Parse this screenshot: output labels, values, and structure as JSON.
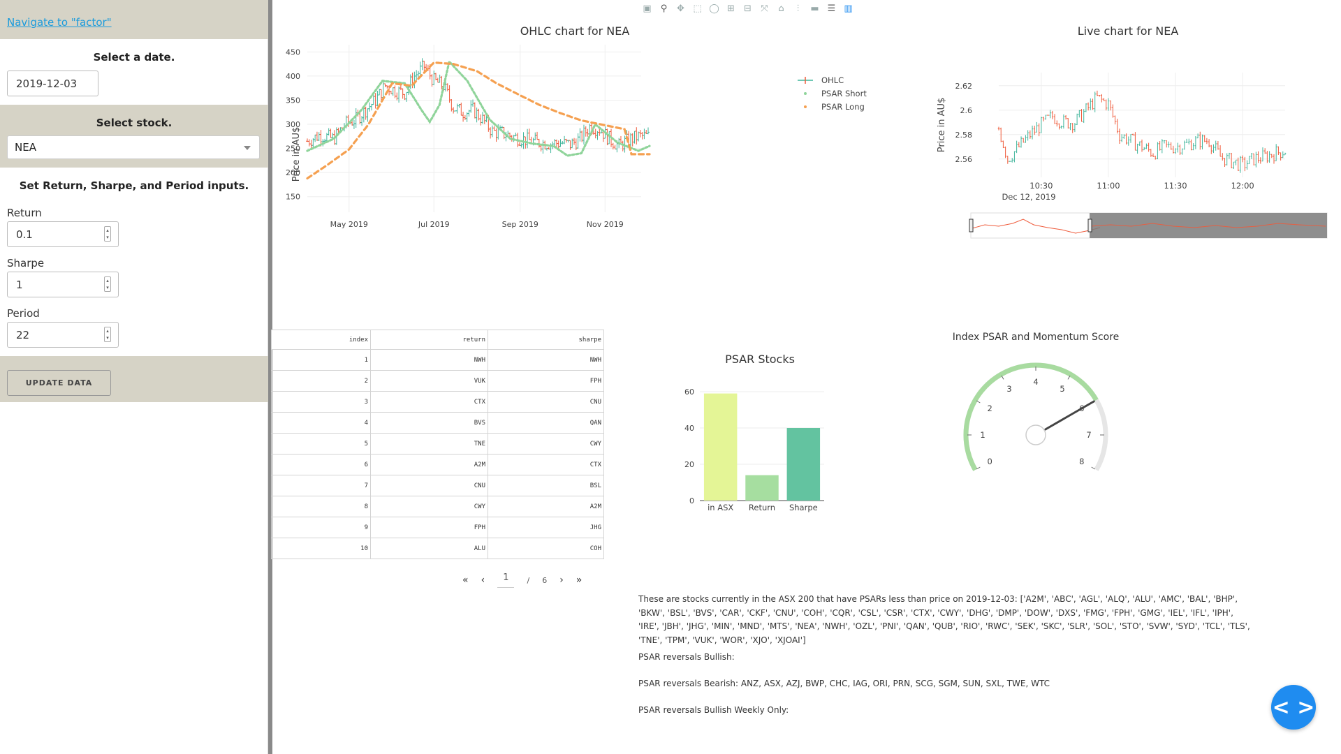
{
  "sidebar": {
    "nav_link": "Navigate to \"factor\"",
    "date_title": "Select a date.",
    "date_value": "2019-12-03",
    "stock_title": "Select stock.",
    "stock_value": "NEA",
    "inputs_title": "Set Return, Sharpe, and Period inputs.",
    "return_label": "Return",
    "return_value": "0.1",
    "sharpe_label": "Sharpe",
    "sharpe_value": "1",
    "period_label": "Period",
    "period_value": "22",
    "update_label": "UPDATE DATA",
    "colors": {
      "band": "#d6d3c6",
      "link": "#1a9bdc"
    }
  },
  "toolbar": {
    "icons": [
      "camera-icon",
      "zoom-icon",
      "pan-icon",
      "box-select-icon",
      "lasso-icon",
      "zoom-in-icon",
      "zoom-out-icon",
      "autoscale-icon",
      "reset-axes-icon",
      "spike-lines-icon",
      "hover-closest-icon",
      "hover-compare-icon",
      "plotly-logo-icon"
    ]
  },
  "chart_data": [
    {
      "type": "ohlc",
      "title": "OHLC chart for NEA",
      "ylabel": "Price in AU$",
      "ylim": [
        125,
        465
      ],
      "yticks": [
        150,
        200,
        250,
        300,
        350,
        400,
        450
      ],
      "xticks": [
        "May 2019",
        "Jul 2019",
        "Sep 2019",
        "Nov 2019"
      ],
      "x_start": "2019-04-01",
      "x_end": "2019-12-03",
      "legend": [
        "OHLC",
        "PSAR Short",
        "PSAR Long"
      ],
      "colors": {
        "up": "#3fb59b",
        "down": "#ef5a3a",
        "psar_short": "#8fd49a",
        "psar_long": "#f5a050"
      },
      "close_series": [
        [
          "2019-04-01",
          265
        ],
        [
          "2019-04-10",
          278
        ],
        [
          "2019-04-20",
          270
        ],
        [
          "2019-04-28",
          300
        ],
        [
          "2019-05-06",
          310
        ],
        [
          "2019-05-13",
          330
        ],
        [
          "2019-05-20",
          350
        ],
        [
          "2019-05-27",
          380
        ],
        [
          "2019-06-03",
          370
        ],
        [
          "2019-06-10",
          365
        ],
        [
          "2019-06-17",
          400
        ],
        [
          "2019-06-24",
          420
        ],
        [
          "2019-07-01",
          390
        ],
        [
          "2019-07-08",
          380
        ],
        [
          "2019-07-15",
          335
        ],
        [
          "2019-07-22",
          325
        ],
        [
          "2019-07-29",
          330
        ],
        [
          "2019-08-05",
          310
        ],
        [
          "2019-08-12",
          285
        ],
        [
          "2019-08-19",
          282
        ],
        [
          "2019-08-26",
          275
        ],
        [
          "2019-09-02",
          270
        ],
        [
          "2019-09-09",
          265
        ],
        [
          "2019-09-16",
          262
        ],
        [
          "2019-09-23",
          260
        ],
        [
          "2019-09-30",
          262
        ],
        [
          "2019-10-07",
          258
        ],
        [
          "2019-10-14",
          270
        ],
        [
          "2019-10-21",
          295
        ],
        [
          "2019-10-28",
          290
        ],
        [
          "2019-11-04",
          270
        ],
        [
          "2019-11-11",
          255
        ],
        [
          "2019-11-18",
          268
        ],
        [
          "2019-11-25",
          275
        ],
        [
          "2019-12-03",
          275
        ]
      ],
      "psar_long": [
        [
          "2019-04-01",
          188
        ],
        [
          "2019-04-15",
          215
        ],
        [
          "2019-05-01",
          248
        ],
        [
          "2019-05-15",
          300
        ],
        [
          "2019-06-01",
          385
        ],
        [
          "2019-06-15",
          380
        ],
        [
          "2019-07-01",
          428
        ],
        [
          "2019-07-15",
          425
        ],
        [
          "2019-08-01",
          410
        ],
        [
          "2019-08-15",
          385
        ],
        [
          "2019-09-01",
          360
        ],
        [
          "2019-09-15",
          340
        ],
        [
          "2019-10-01",
          322
        ],
        [
          "2019-10-15",
          308
        ],
        [
          "2019-11-01",
          298
        ],
        [
          "2019-11-15",
          290
        ],
        [
          "2019-11-20",
          238
        ],
        [
          "2019-12-03",
          238
        ]
      ],
      "psar_short": [
        [
          "2019-04-01",
          245
        ],
        [
          "2019-04-20",
          270
        ],
        [
          "2019-05-10",
          330
        ],
        [
          "2019-05-25",
          390
        ],
        [
          "2019-06-10",
          385
        ],
        [
          "2019-06-22",
          330
        ],
        [
          "2019-06-28",
          305
        ],
        [
          "2019-07-05",
          340
        ],
        [
          "2019-07-12",
          430
        ],
        [
          "2019-07-25",
          390
        ],
        [
          "2019-08-10",
          310
        ],
        [
          "2019-08-25",
          270
        ],
        [
          "2019-09-10",
          260
        ],
        [
          "2019-09-25",
          255
        ],
        [
          "2019-10-05",
          235
        ],
        [
          "2019-10-15",
          240
        ],
        [
          "2019-10-25",
          300
        ],
        [
          "2019-11-10",
          262
        ],
        [
          "2019-11-25",
          245
        ],
        [
          "2019-12-03",
          255
        ]
      ]
    },
    {
      "type": "ohlc",
      "title": "Live chart for NEA",
      "ylabel": "Price in AU$",
      "ylim": [
        2.545,
        2.625
      ],
      "yticks": [
        2.56,
        2.58,
        2.6,
        2.62
      ],
      "ytick_labels": [
        "2.56",
        "2.58",
        "2.6",
        "2.62"
      ],
      "xticks": [
        "10:30",
        "11:00",
        "11:30",
        "12:00"
      ],
      "xsubtitle": "Dec 12, 2019",
      "x_start": "10:11",
      "x_end": "12:19",
      "colors": {
        "up": "#3fb59b",
        "down": "#ef5a3a"
      },
      "close_series": [
        [
          "10:11",
          2.585
        ],
        [
          "10:15",
          2.56
        ],
        [
          "10:20",
          2.57
        ],
        [
          "10:25",
          2.58
        ],
        [
          "10:30",
          2.588
        ],
        [
          "10:35",
          2.595
        ],
        [
          "10:40",
          2.59
        ],
        [
          "10:45",
          2.59
        ],
        [
          "10:50",
          2.6
        ],
        [
          "10:55",
          2.61
        ],
        [
          "11:00",
          2.605
        ],
        [
          "11:05",
          2.58
        ],
        [
          "11:10",
          2.575
        ],
        [
          "11:15",
          2.57
        ],
        [
          "11:20",
          2.565
        ],
        [
          "11:25",
          2.57
        ],
        [
          "11:30",
          2.57
        ],
        [
          "11:35",
          2.572
        ],
        [
          "11:40",
          2.575
        ],
        [
          "11:45",
          2.575
        ],
        [
          "11:50",
          2.562
        ],
        [
          "11:55",
          2.558
        ],
        [
          "12:00",
          2.555
        ],
        [
          "12:05",
          2.56
        ],
        [
          "12:10",
          2.562
        ],
        [
          "12:15",
          2.565
        ],
        [
          "12:19",
          2.567
        ]
      ]
    },
    {
      "type": "bar",
      "title": "PSAR Stocks",
      "categories": [
        "in ASX",
        "Return",
        "Sharpe"
      ],
      "values": [
        59,
        14,
        40
      ],
      "ylim": [
        0,
        65
      ],
      "yticks": [
        0,
        20,
        40,
        60
      ],
      "colors": [
        "#e4f596",
        "#a6dea0",
        "#63c3a0"
      ]
    },
    {
      "type": "gauge",
      "title": "Index PSAR and Momentum Score",
      "value": 6,
      "min": 0,
      "max": 8,
      "ticks": [
        0,
        1,
        2,
        3,
        4,
        5,
        6,
        7,
        8
      ],
      "colors": {
        "arc_fill": "#a8dba0",
        "arc_bg": "#e6e6e6",
        "needle": "#444444"
      }
    }
  ],
  "table": {
    "columns": [
      "index",
      "return",
      "sharpe"
    ],
    "rows": [
      [
        "1",
        "NWH",
        "NWH"
      ],
      [
        "2",
        "VUK",
        "FPH"
      ],
      [
        "3",
        "CTX",
        "CNU"
      ],
      [
        "4",
        "BVS",
        "QAN"
      ],
      [
        "5",
        "TNE",
        "CWY"
      ],
      [
        "6",
        "A2M",
        "CTX"
      ],
      [
        "7",
        "CNU",
        "BSL"
      ],
      [
        "8",
        "CWY",
        "A2M"
      ],
      [
        "9",
        "FPH",
        "JHG"
      ],
      [
        "10",
        "ALU",
        "COH"
      ]
    ]
  },
  "pager": {
    "first": "«",
    "prev": "‹",
    "current": "1",
    "sep": "/",
    "total": "6",
    "next": "›",
    "last": "»"
  },
  "info": {
    "stocks_text": "These are stocks currently in the ASX 200 that have PSARs less than price on 2019-12-03: ['A2M', 'ABC', 'AGL', 'ALQ', 'ALU', 'AMC', 'BAL', 'BHP', 'BKW', 'BSL', 'BVS', 'CAR', 'CKF', 'CNU', 'COH', 'CQR', 'CSL', 'CSR', 'CTX', 'CWY', 'DHG', 'DMP', 'DOW', 'DXS', 'FMG', 'FPH', 'GMG', 'IEL', 'IFL', 'IPH', 'IRE', 'JBH', 'JHG', 'MIN', 'MND', 'MTS', 'NEA', 'NWH', 'OZL', 'PNI', 'QAN', 'QUB', 'RIO', 'RWC', 'SEK', 'SKC', 'SLR', 'SOL', 'STO', 'SVW', 'SYD', 'TCL', 'TLS', 'TNE', 'TPM', 'VUK', 'WOR', 'XJO', 'XJOAI']",
    "bullish": "PSAR reversals Bullish:",
    "bearish": "PSAR reversals Bearish: ANZ, ASX, AZJ, BWP, CHC, IAG, ORI, PRN, SCG, SGM, SUN, SXL, TWE, WTC",
    "weekly": "PSAR reversals Bullish Weekly Only:"
  },
  "fab": {
    "icon": "code-icon",
    "glyph": "< >"
  }
}
